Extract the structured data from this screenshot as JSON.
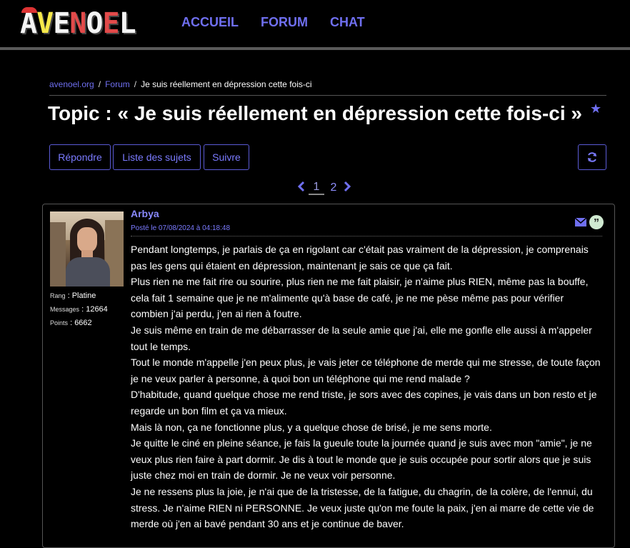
{
  "header": {
    "logo_text": "AVENOEL",
    "nav": [
      "ACCUEIL",
      "FORUM",
      "CHAT"
    ]
  },
  "breadcrumb": {
    "home": "avenoel.org",
    "forum": "Forum",
    "current": "Je suis réellement en dépression cette fois-ci"
  },
  "topic": {
    "title": "Topic : « Je suis réellement en dépression cette fois-ci »"
  },
  "actions": {
    "reply": "Répondre",
    "list": "Liste des sujets",
    "follow": "Suivre"
  },
  "pagination": {
    "pages": [
      "1",
      "2"
    ],
    "current": "1"
  },
  "post": {
    "author": "Arbya",
    "date": "Posté le 07/08/2024 à 04:18:48",
    "rank_label": "Rang",
    "rank_value": "Platine",
    "messages_label": "Messages",
    "messages_value": "12664",
    "points_label": "Points",
    "points_value": "6662",
    "paragraphs": [
      "Pendant longtemps, je parlais de ça en rigolant car c'était pas vraiment de la dépression, je comprenais pas les gens qui étaient en dépression, maintenant je sais ce que ça fait.",
      "Plus rien ne me fait rire ou sourire, plus rien ne me fait plaisir, je n'aime plus RIEN, même pas la bouffe, cela fait 1 semaine que je ne m'alimente qu'à base de café, je ne me pèse même pas pour vérifier combien j'ai perdu, j'en ai rien à foutre.",
      "Je suis même en train de me débarrasser de la seule amie que j'ai, elle me gonfle elle aussi à m'appeler tout le temps.",
      "Tout le monde m'appelle j'en peux plus, je vais jeter ce téléphone de merde qui me stresse, de toute façon je ne veux parler à personne, à quoi bon un téléphone qui me rend malade ?",
      "D'habitude, quand quelque chose me rend triste, je sors avec des copines, je vais dans un bon resto et je regarde un bon film et ça va mieux.",
      "Mais là non, ça ne fonctionne plus, y a quelque chose de brisé, je me sens morte.",
      "Je quitte le ciné en pleine séance, je fais la gueule toute la journée quand je suis avec mon \"amie\", je ne veux plus rien faire à part dormir. Je dis à tout le monde que je suis occupée pour sortir alors que je suis juste chez moi en train de dormir. Je ne veux voir personne.",
      "Je ne ressens plus la joie, je n'ai que de la tristesse, de la fatigue, du chagrin, de la colère, de l'ennui, du stress. Je n'aime RIEN ni PERSONNE. Je veux juste qu'on me foute la paix, j'en ai marre de cette vie de merde où j'en ai bavé pendant 30 ans et je continue de baver."
    ]
  },
  "colors": {
    "accent": "#6f6ff0",
    "background": "#000000",
    "text": "#ffffff"
  }
}
